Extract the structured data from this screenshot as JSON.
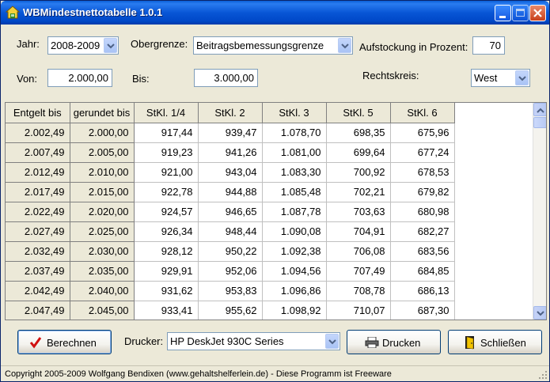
{
  "window": {
    "title": "WBMindestnettotabelle 1.0.1"
  },
  "form": {
    "jahr_label": "Jahr:",
    "jahr_value": "2008-2009",
    "obergrenze_label": "Obergrenze:",
    "obergrenze_value": "Beitragsbemessungsgrenze",
    "aufstockung_label": "Aufstockung in Prozent:",
    "aufstockung_value": "70",
    "von_label": "Von:",
    "von_value": "2.000,00",
    "bis_label": "Bis:",
    "bis_value": "3.000,00",
    "rechtskreis_label": "Rechtskreis:",
    "rechtskreis_value": "West"
  },
  "table": {
    "headers": [
      "Entgelt bis",
      "gerundet bis",
      "StKl. 1/4",
      "StKl. 2",
      "StKl. 3",
      "StKl. 5",
      "StKl. 6"
    ],
    "rows": [
      [
        "2.002,49",
        "2.000,00",
        "917,44",
        "939,47",
        "1.078,70",
        "698,35",
        "675,96"
      ],
      [
        "2.007,49",
        "2.005,00",
        "919,23",
        "941,26",
        "1.081,00",
        "699,64",
        "677,24"
      ],
      [
        "2.012,49",
        "2.010,00",
        "921,00",
        "943,04",
        "1.083,30",
        "700,92",
        "678,53"
      ],
      [
        "2.017,49",
        "2.015,00",
        "922,78",
        "944,88",
        "1.085,48",
        "702,21",
        "679,82"
      ],
      [
        "2.022,49",
        "2.020,00",
        "924,57",
        "946,65",
        "1.087,78",
        "703,63",
        "680,98"
      ],
      [
        "2.027,49",
        "2.025,00",
        "926,34",
        "948,44",
        "1.090,08",
        "704,91",
        "682,27"
      ],
      [
        "2.032,49",
        "2.030,00",
        "928,12",
        "950,22",
        "1.092,38",
        "706,08",
        "683,56"
      ],
      [
        "2.037,49",
        "2.035,00",
        "929,91",
        "952,06",
        "1.094,56",
        "707,49",
        "684,85"
      ],
      [
        "2.042,49",
        "2.040,00",
        "931,62",
        "953,83",
        "1.096,86",
        "708,78",
        "686,13"
      ],
      [
        "2.047,49",
        "2.045,00",
        "933,41",
        "955,62",
        "1.098,92",
        "710,07",
        "687,30"
      ]
    ]
  },
  "actions": {
    "berechnen_label": "Berechnen",
    "drucker_label": "Drucker:",
    "drucker_value": "HP DeskJet 930C Series",
    "drucken_label": "Drucken",
    "schliessen_label": "Schließen"
  },
  "status": {
    "text": "Copyright 2005-2009 Wolfgang Bendixen (www.gehaltshelferlein.de) - Diese Programm ist Freeware"
  },
  "colors": {
    "titlebar": "#0856d6",
    "face": "#ece9d8",
    "check": "#d01010"
  }
}
